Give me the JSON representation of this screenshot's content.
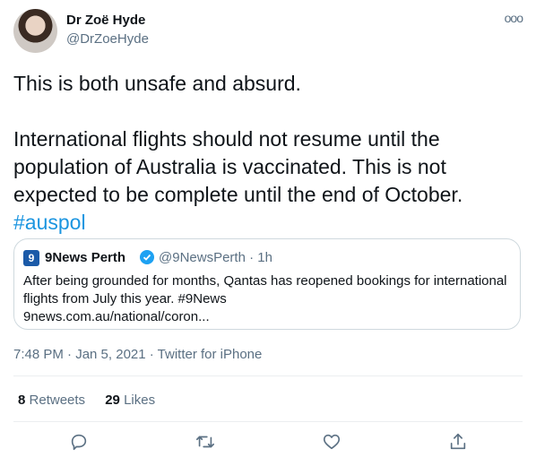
{
  "author": {
    "name": "Dr Zoë Hyde",
    "handle": "@DrZoeHyde"
  },
  "more_label": "ooo",
  "tweet": {
    "text": "This is both unsafe and absurd.\n\nInternational flights should not resume until the population of Australia is vaccinated. This is not expected to be complete until the end of October.",
    "hashtag": "#auspol"
  },
  "quote": {
    "name": "9News Perth",
    "handle_time": "@9NewsPerth · 1h",
    "text": "After being grounded for months, Qantas has reopened bookings for international flights from July this year. #9News\n9news.com.au/national/coron..."
  },
  "meta": {
    "timestamp": "7:48 PM · Jan 5, 2021 · Twitter for iPhone"
  },
  "stats": {
    "retweets_count": "8",
    "retweets_label": "Retweets",
    "likes_count": "29",
    "likes_label": "Likes"
  },
  "icons": [
    "reply-icon",
    "retweet-icon",
    "like-icon",
    "share-icon"
  ],
  "colors": {
    "accent": "#1b95e0",
    "secondary": "#5b7083",
    "border": "#cfd9de"
  }
}
